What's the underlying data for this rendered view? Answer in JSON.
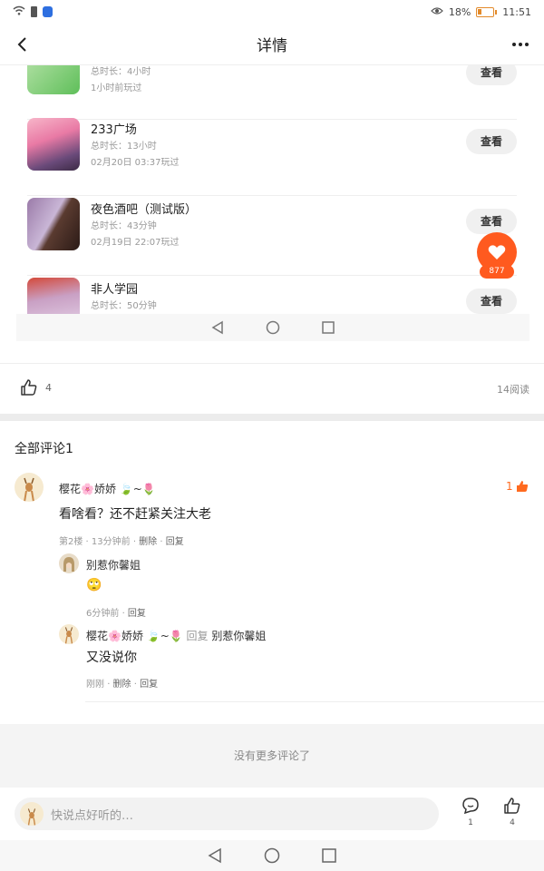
{
  "status_bar": {
    "battery_text": "18%",
    "time": "11:51"
  },
  "header": {
    "title": "详情"
  },
  "embedded_screenshot": {
    "games": [
      {
        "name": "",
        "duration": "总时长：4小时",
        "last_played": "1小时前玩过",
        "button": "查看"
      },
      {
        "name": "233广场",
        "duration": "总时长：13小时",
        "last_played": "02月20日 03:37玩过",
        "button": "查看"
      },
      {
        "name": "夜色酒吧（测试版）",
        "duration": "总时长：43分钟",
        "last_played": "02月19日 22:07玩过",
        "button": "查看"
      },
      {
        "name": "非人学园",
        "duration": "总时长：50分钟",
        "last_played": "",
        "button": "查看"
      }
    ],
    "float_count": "877"
  },
  "stats": {
    "like_count": "4",
    "reads": "14阅读"
  },
  "comments": {
    "title": "全部评论1",
    "main": {
      "author": "樱花🌸娇娇 🍃~🌷",
      "text": "看啥看？还不赶紧关注大老",
      "floor_time": "第2楼 · 13分钟前",
      "delete": "删除",
      "reply": "回复",
      "like_count": "1"
    },
    "replies": [
      {
        "author": "别惹你馨姐",
        "text": "🙄",
        "time": "6分钟前",
        "reply": "回复"
      },
      {
        "author": "樱花🌸娇娇 🍃~🌷",
        "reply_word": "回复",
        "reply_to": "别惹你馨姐",
        "text": "又没说你",
        "time": "刚刚",
        "delete": "删除",
        "reply": "回复"
      }
    ]
  },
  "no_more_text": "没有更多评论了",
  "bottom_bar": {
    "placeholder": "快说点好听的…",
    "comment_count": "1",
    "like_count": "4"
  },
  "colors": {
    "accent": "#ff5a1f",
    "divider": "#ececec",
    "muted_text": "#999999"
  }
}
